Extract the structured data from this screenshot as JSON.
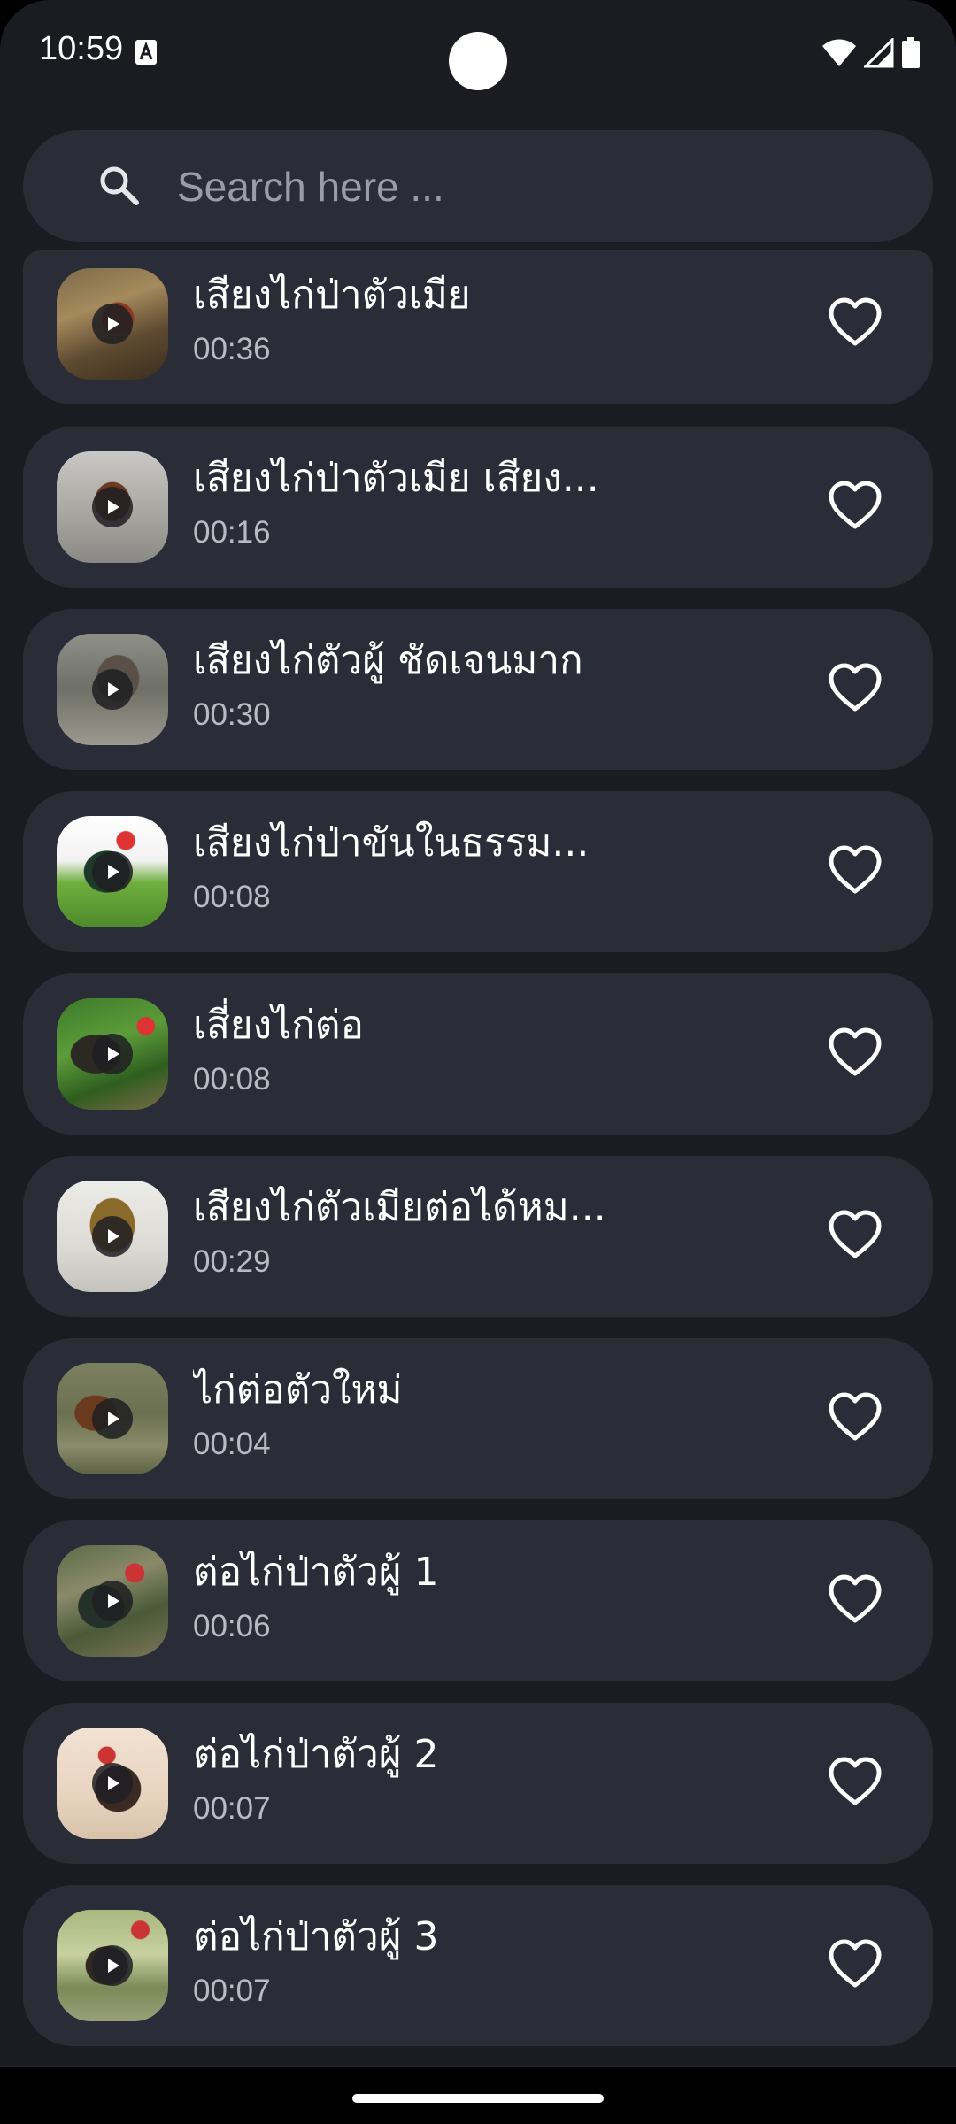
{
  "status_bar": {
    "time": "10:59"
  },
  "search": {
    "placeholder": "Search here ..."
  },
  "items": [
    {
      "title": "เสียงไก่ป่าตัวเมีย",
      "duration": "00:36"
    },
    {
      "title": "เสียงไก่ป่าตัวเมีย เสียง...",
      "duration": "00:16"
    },
    {
      "title": "เสียงไก่ตัวผู้ ชัดเจนมาก",
      "duration": "00:30"
    },
    {
      "title": "เสียงไก่ป่าขันในธรรม...",
      "duration": "00:08"
    },
    {
      "title": "เสี่ยงไก่ต่อ",
      "duration": "00:08"
    },
    {
      "title": "เสียงไก่ตัวเมียต่อได้หม...",
      "duration": "00:29"
    },
    {
      "title": "ไก่ต่อตัวใหม่",
      "duration": "00:04"
    },
    {
      "title": "ต่อไก่ป่าตัวผู้ 1",
      "duration": "00:06"
    },
    {
      "title": "ต่อไก่ป่าตัวผู้ 2",
      "duration": "00:07"
    },
    {
      "title": "ต่อไก่ป่าตัวผู้ 3",
      "duration": "00:07"
    }
  ],
  "icons": {
    "search": "search-icon",
    "favorite": "heart-outline-icon",
    "play": "play-icon"
  },
  "colors": {
    "background": "#1b1c21",
    "card": "#2a2c38",
    "text_primary": "#ffffff",
    "text_secondary": "#b9bac2",
    "placeholder": "#9a9ca6"
  }
}
